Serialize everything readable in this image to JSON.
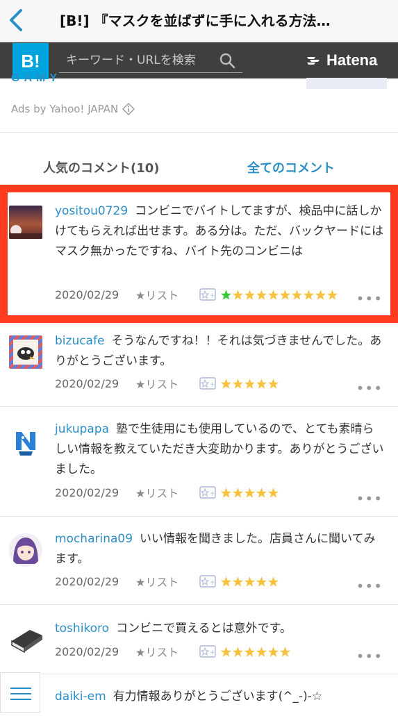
{
  "browser": {
    "title": "[B!] 『マスクを並ばずに手に入れる方法…"
  },
  "header": {
    "logo": "B!",
    "search_placeholder": "キーワード・URLを検索",
    "brand": "Hatena"
  },
  "ad": {
    "brand_fragment": "GAMY",
    "ads_by": "Ads by Yahoo! JAPAN"
  },
  "tabs": {
    "popular": "人気のコメント(10)",
    "all": "全てのコメント"
  },
  "comments": [
    {
      "user": "yositou0729",
      "text": "コンビニでバイトしてますが、検品中に話しかけてもらえれば出せます。ある分は。ただ、バックヤードにはマスク無かったですね、バイト先のコンビニは",
      "date": "2020/02/29",
      "list_label": "★リスト",
      "green_stars": 1,
      "yellow_stars": 9,
      "highlighted": true
    },
    {
      "user": "bizucafe",
      "text": "そうなんですね！！それは気づきませんでした。ありがとうございます。",
      "date": "2020/02/29",
      "list_label": "★リスト",
      "green_stars": 0,
      "yellow_stars": 5
    },
    {
      "user": "jukupapa",
      "text": "塾で生徒用にも使用しているので、とても素晴らしい情報を教えていただき大変助かります。ありがとうございました。",
      "date": "2020/02/29",
      "list_label": "★リスト",
      "green_stars": 0,
      "yellow_stars": 5
    },
    {
      "user": "mocharina09",
      "text": "いい情報を聞きました。店員さんに聞いてみます。",
      "date": "2020/02/29",
      "list_label": "★リスト",
      "green_stars": 0,
      "yellow_stars": 5
    },
    {
      "user": "toshikoro",
      "text": "コンビニで買えるとは意外です。",
      "date": "2020/02/29",
      "list_label": "★リスト",
      "green_stars": 0,
      "yellow_stars": 6
    },
    {
      "user": "daiki-em",
      "text": "有力情報ありがとうございます(^_-)-☆"
    }
  ],
  "icons": {
    "back": "chevron-left-icon",
    "search": "search-icon",
    "menu": "hamburger-menu-icon",
    "add_star": "add-star-icon",
    "more": "more-dots-icon"
  },
  "colors": {
    "accent": "#2b8fc7",
    "hatena_blue": "#00a4de",
    "header_bg": "#3f3f3f",
    "highlight": "#ff3b1f",
    "star_yellow": "#f5c242",
    "star_green": "#37c837"
  }
}
